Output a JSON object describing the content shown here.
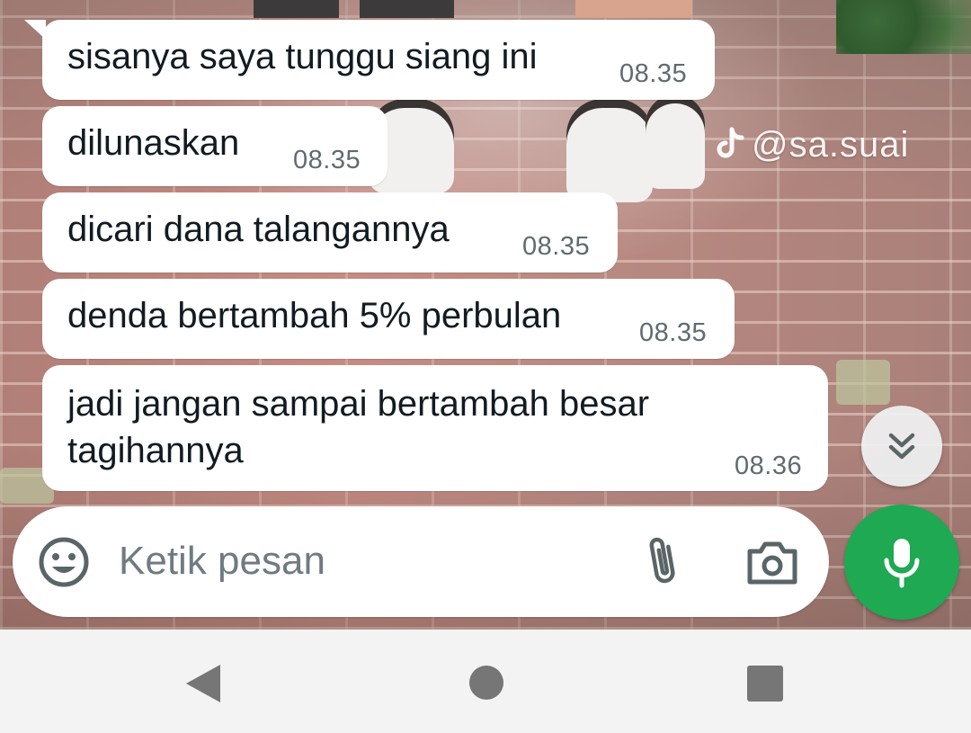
{
  "watermark": {
    "text": "@sa.suai",
    "icon": "tiktok-icon"
  },
  "messages": [
    {
      "text": "sisanya saya tunggu siang ini",
      "time": "08.35"
    },
    {
      "text": "dilunaskan",
      "time": "08.35"
    },
    {
      "text": "dicari dana talangannya",
      "time": "08.35"
    },
    {
      "text": "denda bertambah 5% perbulan",
      "time": "08.35"
    },
    {
      "text_line1": "jadi jangan sampai bertambah besar",
      "text_line2": "tagihannya",
      "time": "08.36"
    }
  ],
  "composer": {
    "placeholder": "Ketik pesan",
    "emoji_icon": "emoji-icon",
    "attach_icon": "paperclip-icon",
    "camera_icon": "camera-icon",
    "mic_icon": "microphone-icon"
  },
  "scroll_button": {
    "icon": "double-chevron-down-icon"
  },
  "navbar": {
    "back_icon": "back-triangle-icon",
    "home_icon": "home-circle-icon",
    "recent_icon": "recent-square-icon"
  },
  "colors": {
    "bubble": "#ffffff",
    "mic_button": "#1ea952",
    "timestamp": "#5f6b70",
    "message_text": "#111b21",
    "navbar": "#f3f3f3"
  }
}
